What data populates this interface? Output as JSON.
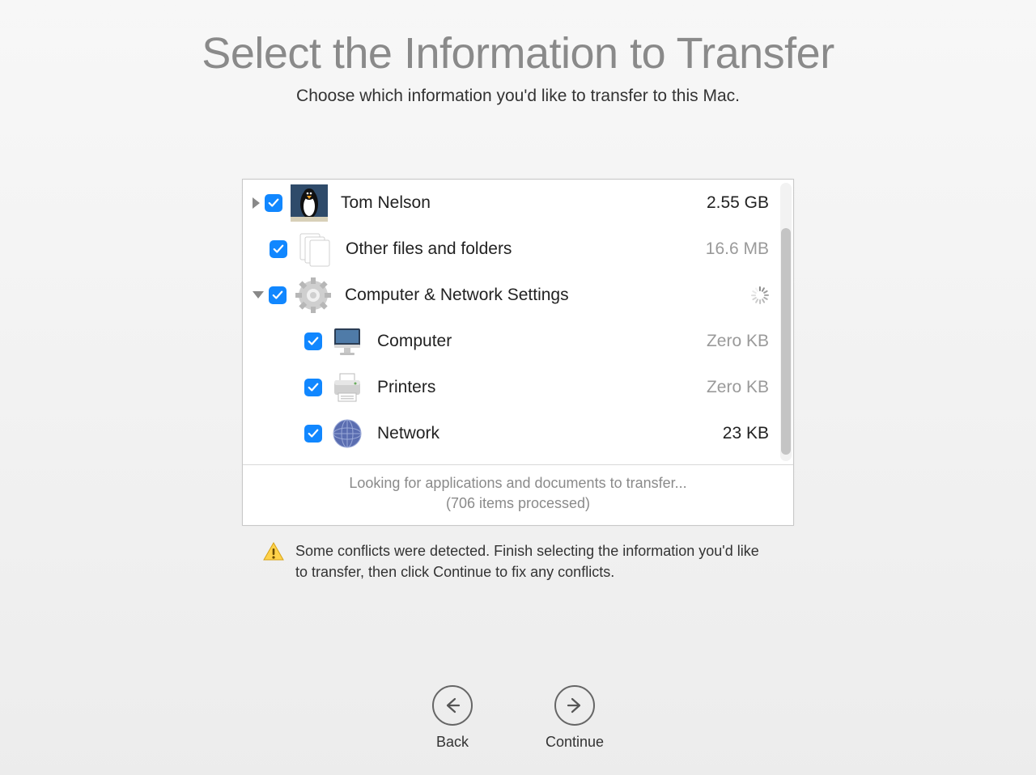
{
  "title": "Select the Information to Transfer",
  "subtitle": "Choose which information you'd like to transfer to this Mac.",
  "items": {
    "0": {
      "label": "Tom Nelson",
      "size": "2.55 GB",
      "checked": true,
      "icon": "penguin"
    },
    "1": {
      "label": "Other files and folders",
      "size": "16.6 MB",
      "checked": true,
      "icon": "files"
    },
    "2": {
      "label": "Computer & Network Settings",
      "checked": true,
      "icon": "gear",
      "loading": true
    },
    "3": {
      "label": "Computer",
      "size": "Zero KB",
      "checked": true,
      "icon": "imac"
    },
    "4": {
      "label": "Printers",
      "size": "Zero KB",
      "checked": true,
      "icon": "printer"
    },
    "5": {
      "label": "Network",
      "size": "23 KB",
      "checked": true,
      "icon": "network-globe"
    }
  },
  "status": {
    "line1": "Looking for applications and documents to transfer...",
    "line2": "(706 items processed)"
  },
  "warning": "Some conflicts were detected. Finish selecting the information you'd like to transfer, then click Continue to fix any conflicts.",
  "nav": {
    "back": "Back",
    "continue": "Continue"
  }
}
